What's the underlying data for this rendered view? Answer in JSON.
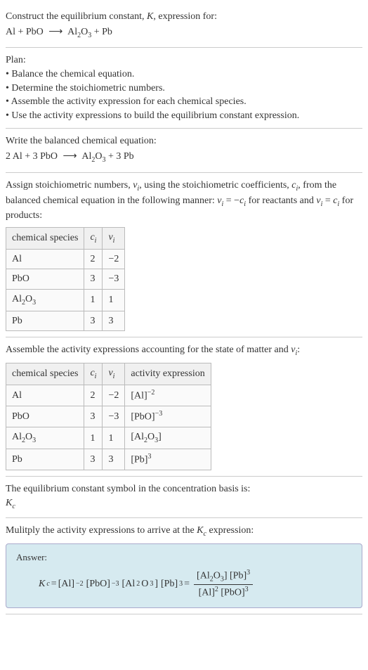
{
  "header": {
    "title_line1": "Construct the equilibrium constant, ",
    "title_K": "K",
    "title_line1_cont": ", expression for:",
    "equation_left": "Al + PbO",
    "equation_arrow": "⟶",
    "equation_right_al2o3": "Al",
    "equation_right_sub1": "2",
    "equation_right_o": "O",
    "equation_right_sub2": "3",
    "equation_right_pb": " + Pb"
  },
  "plan": {
    "title": "Plan:",
    "b1": "• Balance the chemical equation.",
    "b2": "• Determine the stoichiometric numbers.",
    "b3": "• Assemble the activity expression for each chemical species.",
    "b4": "• Use the activity expressions to build the equilibrium constant expression."
  },
  "balanced": {
    "intro": "Write the balanced chemical equation:",
    "left": "2 Al + 3 PbO",
    "arrow": "⟶",
    "al": "Al",
    "sub1": "2",
    "o": "O",
    "sub2": "3",
    "rest": " + 3 Pb"
  },
  "stoich": {
    "intro1": "Assign stoichiometric numbers, ",
    "nu": "ν",
    "sub_i": "i",
    "intro2": ", using the stoichiometric coefficients, ",
    "c": "c",
    "intro3": ", from the balanced chemical equation in the following manner: ",
    "eq1_lhs": "ν",
    "eq1_eq": " = −",
    "intro4": " for reactants and ",
    "eq2_eq": " = ",
    "intro5": " for products:",
    "table": {
      "h1": "chemical species",
      "h2_c": "c",
      "h3_nu": "ν",
      "rows": [
        {
          "species": "Al",
          "c": "2",
          "nu": "−2"
        },
        {
          "species": "PbO",
          "c": "3",
          "nu": "−3"
        },
        {
          "species_al": "Al",
          "s1": "2",
          "species_o": "O",
          "s2": "3",
          "c": "1",
          "nu": "1"
        },
        {
          "species": "Pb",
          "c": "3",
          "nu": "3"
        }
      ]
    }
  },
  "activity": {
    "intro1": "Assemble the activity expressions accounting for the state of matter and ",
    "nu": "ν",
    "sub_i": "i",
    "intro2": ":",
    "table": {
      "h1": "chemical species",
      "h2_c": "c",
      "h3_nu": "ν",
      "h4": "activity expression",
      "rows": [
        {
          "species": "Al",
          "c": "2",
          "nu": "−2",
          "expr_base": "[Al]",
          "expr_sup": "−2"
        },
        {
          "species": "PbO",
          "c": "3",
          "nu": "−3",
          "expr_base": "[PbO]",
          "expr_sup": "−3"
        },
        {
          "species_al": "Al",
          "s1": "2",
          "species_o": "O",
          "s2": "3",
          "c": "1",
          "nu": "1",
          "expr_al": "[Al",
          "expr_s1": "2",
          "expr_o": "O",
          "expr_s2": "3",
          "expr_close": "]"
        },
        {
          "species": "Pb",
          "c": "3",
          "nu": "3",
          "expr_base": "[Pb]",
          "expr_sup": "3"
        }
      ]
    }
  },
  "symbol": {
    "intro": "The equilibrium constant symbol in the concentration basis is:",
    "K": "K",
    "sub_c": "c"
  },
  "multiply": {
    "intro1": "Mulitply the activity expressions to arrive at the ",
    "K": "K",
    "sub_c": "c",
    "intro2": " expression:"
  },
  "answer": {
    "label": "Answer:",
    "K": "K",
    "sub_c": "c",
    "eq": " = ",
    "t1": "[Al]",
    "t1sup": "−2",
    "sp": " ",
    "t2": "[PbO]",
    "t2sup": "−3",
    "t3_al": "[Al",
    "t3_s1": "2",
    "t3_o": "O",
    "t3_s2": "3",
    "t3_close": "]",
    "t4": "[Pb]",
    "t4sup": "3",
    "eq2": " = ",
    "num_al": "[Al",
    "num_s1": "2",
    "num_o": "O",
    "num_s2": "3",
    "num_close": "] ",
    "num_pb": "[Pb]",
    "num_pbsup": "3",
    "den_al": "[Al]",
    "den_alsup": "2",
    "den_pbo": " [PbO]",
    "den_pbosup": "3"
  }
}
